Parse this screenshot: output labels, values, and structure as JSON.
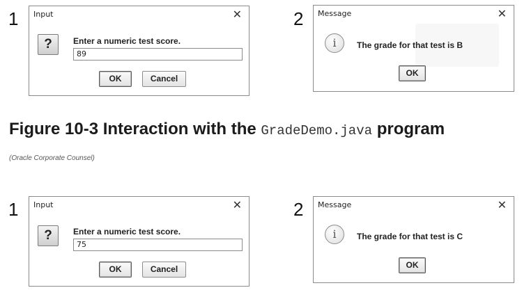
{
  "figure": {
    "caption_prefix": "Figure 10-3 Interaction with the",
    "caption_code": "GradeDemo.java",
    "caption_suffix": "program",
    "credit": "(Oracle Corporate Counsel)"
  },
  "rows": [
    {
      "input_step": "1",
      "input_dialog": {
        "title": "Input",
        "close_icon": "✕",
        "icon": "?",
        "prompt": "Enter a numeric test score.",
        "value": "89",
        "ok_label": "OK",
        "cancel_label": "Cancel"
      },
      "message_step": "2",
      "message_dialog": {
        "title": "Message",
        "close_icon": "✕",
        "icon": "i",
        "text": "The grade for that test is B",
        "ok_label": "OK"
      }
    },
    {
      "input_step": "1",
      "input_dialog": {
        "title": "Input",
        "close_icon": "✕",
        "icon": "?",
        "prompt": "Enter a numeric test score.",
        "value": "75",
        "ok_label": "OK",
        "cancel_label": "Cancel"
      },
      "message_step": "2",
      "message_dialog": {
        "title": "Message",
        "close_icon": "✕",
        "icon": "i",
        "text": "The grade for that test is C",
        "ok_label": "OK"
      }
    }
  ]
}
